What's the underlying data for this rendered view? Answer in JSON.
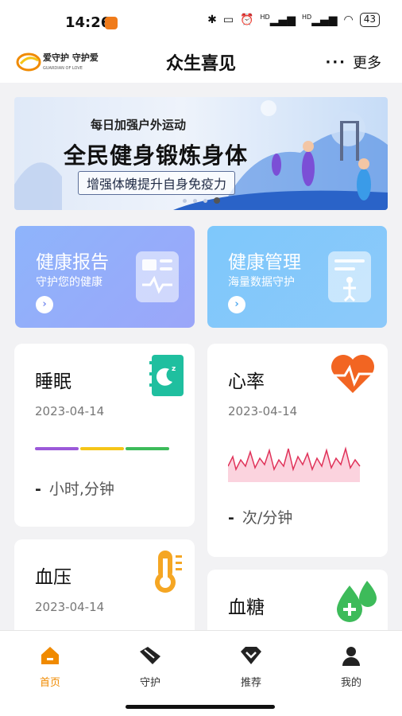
{
  "status": {
    "time": "14:26",
    "battery": "43",
    "signal_1": "HD",
    "signal_2": "HD"
  },
  "header": {
    "logo_text": "爱守护 守护爱",
    "logo_sub": "GUARDIAN OF LOVE",
    "title": "众生喜见",
    "more_label": "更多"
  },
  "banner": {
    "subtitle": "每日加强户外运动",
    "title": "全民健身锻炼身体",
    "tagline": "增强体魄提升自身免疫力",
    "active_index": 3,
    "dot_count": 4
  },
  "tiles": [
    {
      "title": "健康报告",
      "subtitle": "守护您的健康"
    },
    {
      "title": "健康管理",
      "subtitle": "海量数据守护"
    }
  ],
  "cards": {
    "sleep": {
      "title": "睡眠",
      "date": "2023-04-14",
      "value": "-",
      "unit": "小时,分钟"
    },
    "heart": {
      "title": "心率",
      "date": "2023-04-14",
      "value": "-",
      "unit": "次/分钟"
    },
    "bp": {
      "title": "血压",
      "date": "2023-04-14"
    },
    "glucose": {
      "title": "血糖"
    }
  },
  "tabbar": [
    {
      "label": "首页",
      "icon": "home-icon",
      "active": true
    },
    {
      "label": "守护",
      "icon": "guard-icon",
      "active": false
    },
    {
      "label": "推荐",
      "icon": "recommend-icon",
      "active": false
    },
    {
      "label": "我的",
      "icon": "profile-icon",
      "active": false
    }
  ],
  "colors": {
    "accent": "#f08a00",
    "sleep_bar_1": "#9b59d9",
    "sleep_bar_2": "#f5c518",
    "sleep_bar_3": "#3dbb5a",
    "heart": "#f26522",
    "sleep_icon": "#1fbf9f",
    "bp_icon": "#f5a623",
    "glucose_icon": "#3dbb5a"
  }
}
